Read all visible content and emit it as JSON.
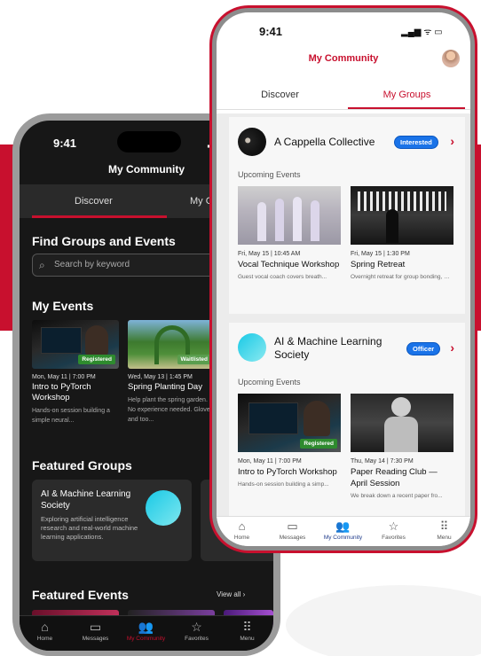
{
  "colors": {
    "brand_red": "#c8102e",
    "accent_blue": "#1a73e8",
    "registered_green": "#2e8b2e",
    "waitlisted_green": "#5a9e4e"
  },
  "dark": {
    "status_time": "9:41",
    "title": "My Community",
    "tabs": [
      "Discover",
      "My Gro"
    ],
    "find_heading": "Find Groups and Events",
    "search_placeholder": "Search by keyword",
    "my_events_heading": "My Events",
    "events": [
      {
        "date": "Mon, May 11 | 7:00 PM",
        "name": "Intro to PyTorch Workshop",
        "badge": "Registered",
        "desc": "Hands-on session building a simple neural..."
      },
      {
        "date": "Wed, May 13 | 1:45 PM",
        "name": "Spring Planting Day",
        "badge": "Waitlisted",
        "desc": "Help plant the spring garden. No experience needed. Gloves and too..."
      }
    ],
    "featured_groups_heading": "Featured Groups",
    "featured_group": {
      "name": "AI & Machine Learning Society",
      "desc": "Exploring artificial intelligence research and real-world machine learning applications."
    },
    "featured_events_heading": "Featured Events",
    "view_all": "View all",
    "nav": [
      {
        "icon": "home-icon",
        "label": "Home"
      },
      {
        "icon": "messages-icon",
        "label": "Messages"
      },
      {
        "icon": "community-icon",
        "label": "My Community"
      },
      {
        "icon": "favorites-icon",
        "label": "Favorites"
      },
      {
        "icon": "menu-icon",
        "label": "Menu"
      }
    ]
  },
  "light": {
    "status_time": "9:41",
    "title": "My Community",
    "tabs": [
      "Discover",
      "My Groups"
    ],
    "groups": [
      {
        "name": "A Cappella Collective",
        "status": "Interested",
        "upcoming_label": "Upcoming Events",
        "events": [
          {
            "date": "Fri, May 15 | 10:45 AM",
            "name": "Vocal Technique Workshop",
            "desc": "Guest vocal coach covers breath..."
          },
          {
            "date": "Fri, May 15 | 1:30 PM",
            "name": "Spring Retreat",
            "desc": "Overnight retreat for group bonding, music workshopping, and plannin..."
          }
        ]
      },
      {
        "name": "AI & Machine Learning Society",
        "status": "Officer",
        "upcoming_label": "Upcoming Events",
        "events": [
          {
            "date": "Mon, May 11 | 7:00 PM",
            "name": "Intro to PyTorch Workshop",
            "badge": "Registered",
            "desc": "Hands-on session building a simp..."
          },
          {
            "date": "Thu, May 14 | 7:30 PM",
            "name": "Paper Reading Club — April Session",
            "desc": "We break down a recent paper fro..."
          }
        ]
      }
    ],
    "nav": [
      {
        "icon": "home-icon",
        "label": "Home"
      },
      {
        "icon": "messages-icon",
        "label": "Messages"
      },
      {
        "icon": "community-icon",
        "label": "My Community"
      },
      {
        "icon": "favorites-icon",
        "label": "Favorites"
      },
      {
        "icon": "menu-icon",
        "label": "Menu"
      }
    ]
  }
}
